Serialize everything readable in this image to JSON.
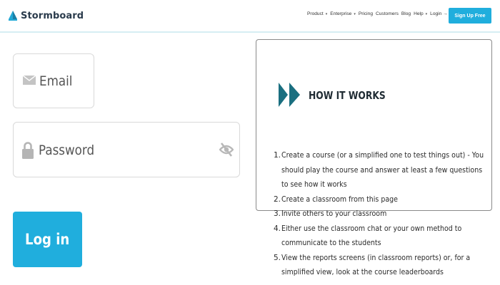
{
  "header": {
    "logo_text": "Stormboard",
    "nav": [
      {
        "label": "Product",
        "caret": true
      },
      {
        "label": "Enterprise",
        "caret": true
      },
      {
        "label": "Pricing",
        "caret": false
      },
      {
        "label": "Customers",
        "caret": false
      },
      {
        "label": "Blog",
        "caret": false
      },
      {
        "label": "Help",
        "caret": true
      },
      {
        "label": "Login →",
        "caret": false
      }
    ],
    "signup_label": "Sign Up Free"
  },
  "login": {
    "email_placeholder": "Email",
    "password_placeholder": "Password",
    "login_label": "Log in"
  },
  "how_it_works": {
    "title": "HOW IT WORKS",
    "steps": [
      {
        "num": "1.",
        "text": "Create a course (or a simplified one to test things out) - You should play the course and answer at least a few questions to see how it works"
      },
      {
        "num": "2.",
        "text": "Create a classroom from this page"
      },
      {
        "num": "3.",
        "text": "Invite others to your classroom"
      },
      {
        "num": "4.",
        "text": "Either use the classroom chat or your own method to communicate to the students"
      },
      {
        "num": "5.",
        "text": "View the reports screens (in classroom reports) or, for a simplified view, look at the course leaderboards"
      }
    ]
  },
  "colors": {
    "accent": "#20aedd",
    "heading": "#1f2b33",
    "chevron": "#1a6f80"
  },
  "icons": {
    "logo": "stormboard-logo-icon",
    "email": "envelope-icon",
    "password": "lock-icon",
    "visibility": "eye-off-icon",
    "how_it_works": "double-chevron-icon"
  }
}
